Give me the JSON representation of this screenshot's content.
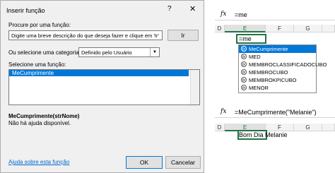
{
  "dialog": {
    "title": "Inserir função",
    "help_glyph": "?",
    "close_glyph": "✕",
    "search_label": "Procure por uma função:",
    "search_value": "Digite uma breve descrição do que deseja fazer e clique em 'Ir'",
    "go_label": "Ir",
    "category_label": "Ou selecione uma categoria:",
    "category_value": "Definido pelo Usuário",
    "select_label": "Selecione uma função:",
    "functions": [
      "MeCumprimente"
    ],
    "signature": "MeCumprimente(strNome)",
    "no_help": "Não há ajuda disponível.",
    "help_link": "Ajuda sobre esta função",
    "ok_label": "OK",
    "cancel_label": "Cancelar"
  },
  "excel_top": {
    "fx": "fx",
    "formula": "=me",
    "columns": [
      "D",
      "E",
      "F",
      "G"
    ],
    "active_column": "E",
    "cell_text": "=me",
    "autocomplete": [
      "MeCumprimente",
      "MED",
      "MEMBROCLASSIFICADOCUBO",
      "MEMBROCUBO",
      "MEMBROKPICUBO",
      "MENOR"
    ]
  },
  "excel_bottom": {
    "fx": "fx",
    "formula": "=MeCumprimente(\"Melanie\")",
    "columns": [
      "D",
      "E",
      "F",
      "G"
    ],
    "active_column": "E",
    "cell_result": "Bom Dia Melanie"
  },
  "colors": {
    "selection": "#0078d7",
    "excel_green": "#217346",
    "link": "#0066cc"
  }
}
